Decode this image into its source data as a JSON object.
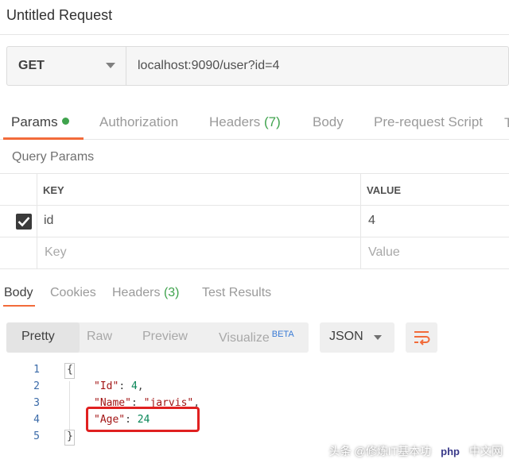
{
  "window": {
    "title": "Untitled Request"
  },
  "request": {
    "method": "GET",
    "url": "localhost:9090/user?id=4"
  },
  "request_tabs": [
    {
      "label": "Params",
      "active": true,
      "indicator": "green-dot-icon"
    },
    {
      "label": "Authorization"
    },
    {
      "label": "Headers",
      "count": "(7)"
    },
    {
      "label": "Body"
    },
    {
      "label": "Pre-request Script"
    },
    {
      "label": "T"
    }
  ],
  "query_params": {
    "section_label": "Query Params",
    "headers": {
      "key": "KEY",
      "value": "VALUE"
    },
    "rows": [
      {
        "checked": true,
        "key": "id",
        "value": "4"
      }
    ],
    "placeholder": {
      "key": "Key",
      "value": "Value"
    }
  },
  "response_tabs": [
    {
      "label": "Body",
      "active": true
    },
    {
      "label": "Cookies"
    },
    {
      "label": "Headers",
      "count": "(3)"
    },
    {
      "label": "Test Results"
    }
  ],
  "view_modes": {
    "pretty": "Pretty",
    "raw": "Raw",
    "preview": "Preview",
    "visualize": "Visualize",
    "beta": "BETA"
  },
  "format": {
    "selected": "JSON"
  },
  "code": {
    "line_numbers": [
      "1",
      "2",
      "3",
      "4",
      "5"
    ],
    "open_brace": "{",
    "close_brace": "}",
    "lines": [
      {
        "key": "\"Id\"",
        "sep": ": ",
        "value": "4",
        "trail": ","
      },
      {
        "key": "\"Name\"",
        "sep": ": ",
        "value": "\"jarvis\"",
        "trail": ","
      },
      {
        "key": "\"Age\"",
        "sep": ": ",
        "value": "24",
        "trail": ""
      }
    ]
  },
  "watermark": {
    "text": "头条 @修炼IT基本功",
    "logo": "php",
    "logo_suffix": "中文网"
  },
  "colors": {
    "accent": "#f26b3a",
    "active_dot": "#3fa34d",
    "highlight_box": "#e02020"
  }
}
